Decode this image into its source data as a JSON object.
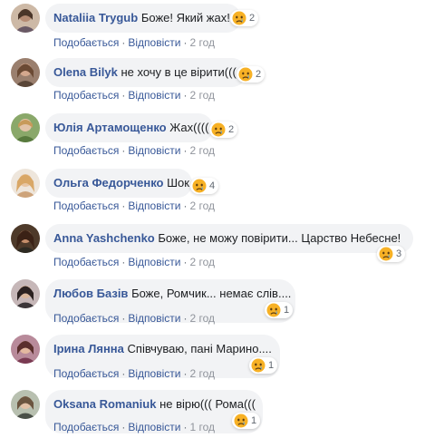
{
  "colors": {
    "author": "#385898",
    "bubble_bg": "#f2f3f5",
    "reaction_yellow": "#f7b125"
  },
  "comments": [
    {
      "author": "Nataliia Trygub",
      "text": "Боже! Який жах!",
      "reaction_icon": "sad-face-icon",
      "reaction_count": "2",
      "like_label": "Подобається",
      "reply_label": "Відповісти",
      "time": "2 год"
    },
    {
      "author": "Olena Bilyk",
      "text": "не хочу в це вірити(((",
      "reaction_icon": "sad-face-icon",
      "reaction_count": "2",
      "like_label": "Подобається",
      "reply_label": "Відповісти",
      "time": "2 год"
    },
    {
      "author": "Юлія Артамощенко",
      "text": "Жах((((",
      "reaction_icon": "sad-face-icon",
      "reaction_count": "2",
      "like_label": "Подобається",
      "reply_label": "Відповісти",
      "time": "2 год"
    },
    {
      "author": "Ольга Федорченко",
      "text": "Шок",
      "reaction_icon": "sad-face-icon",
      "reaction_count": "4",
      "like_label": "Подобається",
      "reply_label": "Відповісти",
      "time": "2 год"
    },
    {
      "author": "Anna Yashchenko",
      "text": "Боже, не можу повірити... Царство Небесне!",
      "reaction_icon": "sad-face-icon",
      "reaction_count": "3",
      "like_label": "Подобається",
      "reply_label": "Відповісти",
      "time": "2 год"
    },
    {
      "author": "Любов Базів",
      "text": "Боже, Ромчик... немає слів....",
      "reaction_icon": "sad-face-icon",
      "reaction_count": "1",
      "like_label": "Подобається",
      "reply_label": "Відповісти",
      "time": "2 год"
    },
    {
      "author": "Ірина Лянна",
      "text": "Співчуваю, пані Марино....",
      "reaction_icon": "sad-face-icon",
      "reaction_count": "1",
      "like_label": "Подобається",
      "reply_label": "Відповісти",
      "time": "2 год"
    },
    {
      "author": "Oksana Romaniuk",
      "text": "не вірю((( Рома(((",
      "reaction_icon": "sad-face-icon",
      "reaction_count": "1",
      "like_label": "Подобається",
      "reply_label": "Відповісти",
      "time": "1 год"
    }
  ]
}
